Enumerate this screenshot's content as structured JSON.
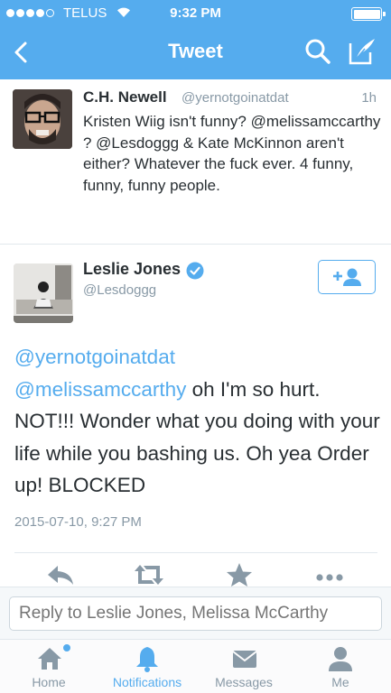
{
  "status_bar": {
    "carrier": "TELUS",
    "time": "9:32 PM",
    "signal_bars": 4,
    "battery_level": 1.0
  },
  "nav": {
    "title": "Tweet",
    "back_icon": "chevron-left-icon",
    "search_icon": "search-icon",
    "compose_icon": "compose-icon"
  },
  "parent_tweet": {
    "name": "C.H. Newell",
    "handle": "@yernotgoinatdat",
    "time": "1h",
    "text": "Kristen Wiig isn't funny? @melissamccarthy ? @Lesdoggg & Kate McKinnon aren't either? Whatever the fuck ever. 4 funny, funny, funny people."
  },
  "main_tweet": {
    "name": "Leslie Jones",
    "handle": "@Lesdoggg",
    "verified": true,
    "mention1": "@yernotgoinatdat",
    "mention2": "@melissamccarthy",
    "text_rest": " oh I'm so hurt. NOT!!! Wonder what you doing with your life while you bashing us. Oh yea Order up! BLOCKED",
    "date": "2015-07-10, 9:27 PM",
    "actions": [
      "reply-icon",
      "retweet-icon",
      "favorite-icon",
      "more-icon"
    ]
  },
  "reply": {
    "placeholder": "Reply to Leslie Jones, Melissa McCarthy"
  },
  "tabs": [
    {
      "label": "Home",
      "icon": "home-icon",
      "badge": true
    },
    {
      "label": "Notifications",
      "icon": "notifications-icon",
      "active": true
    },
    {
      "label": "Messages",
      "icon": "messages-icon"
    },
    {
      "label": "Me",
      "icon": "me-icon"
    }
  ],
  "colors": {
    "brand": "#55acee",
    "text": "#292f33",
    "muted": "#8899a6",
    "border": "#e1e8ed"
  }
}
